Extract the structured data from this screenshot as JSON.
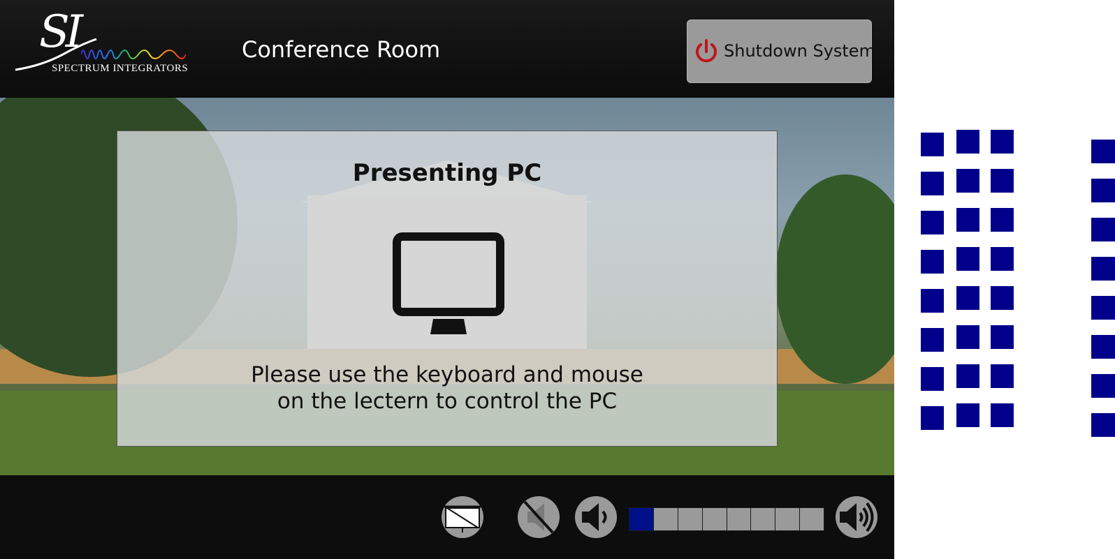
{
  "header": {
    "logo_script": "SI",
    "logo_text": "SPECTRUM INTEGRATORS",
    "room_title": "Conference Room",
    "shutdown_label": "Shutdown System",
    "shutdown_icon": "power-icon"
  },
  "main": {
    "title": "Presenting PC",
    "icon": "monitor-icon",
    "instruction_line1": "Please use the keyboard and mouse",
    "instruction_line2": "on the lectern to control the PC"
  },
  "footer": {
    "buttons": [
      {
        "name": "screen-toggle-button",
        "icon": "screen-off-icon"
      },
      {
        "name": "mute-button",
        "icon": "speaker-muted-icon"
      },
      {
        "name": "volume-down-button",
        "icon": "speaker-low-icon"
      },
      {
        "name": "volume-up-button",
        "icon": "speaker-high-icon"
      }
    ],
    "volume_level": 1,
    "volume_segments": 8
  },
  "colors": {
    "accent_blue": "#00108A",
    "power_red": "#C0141C",
    "button_gray": "#9A9A9A",
    "bar_black": "#0D0D0D"
  }
}
